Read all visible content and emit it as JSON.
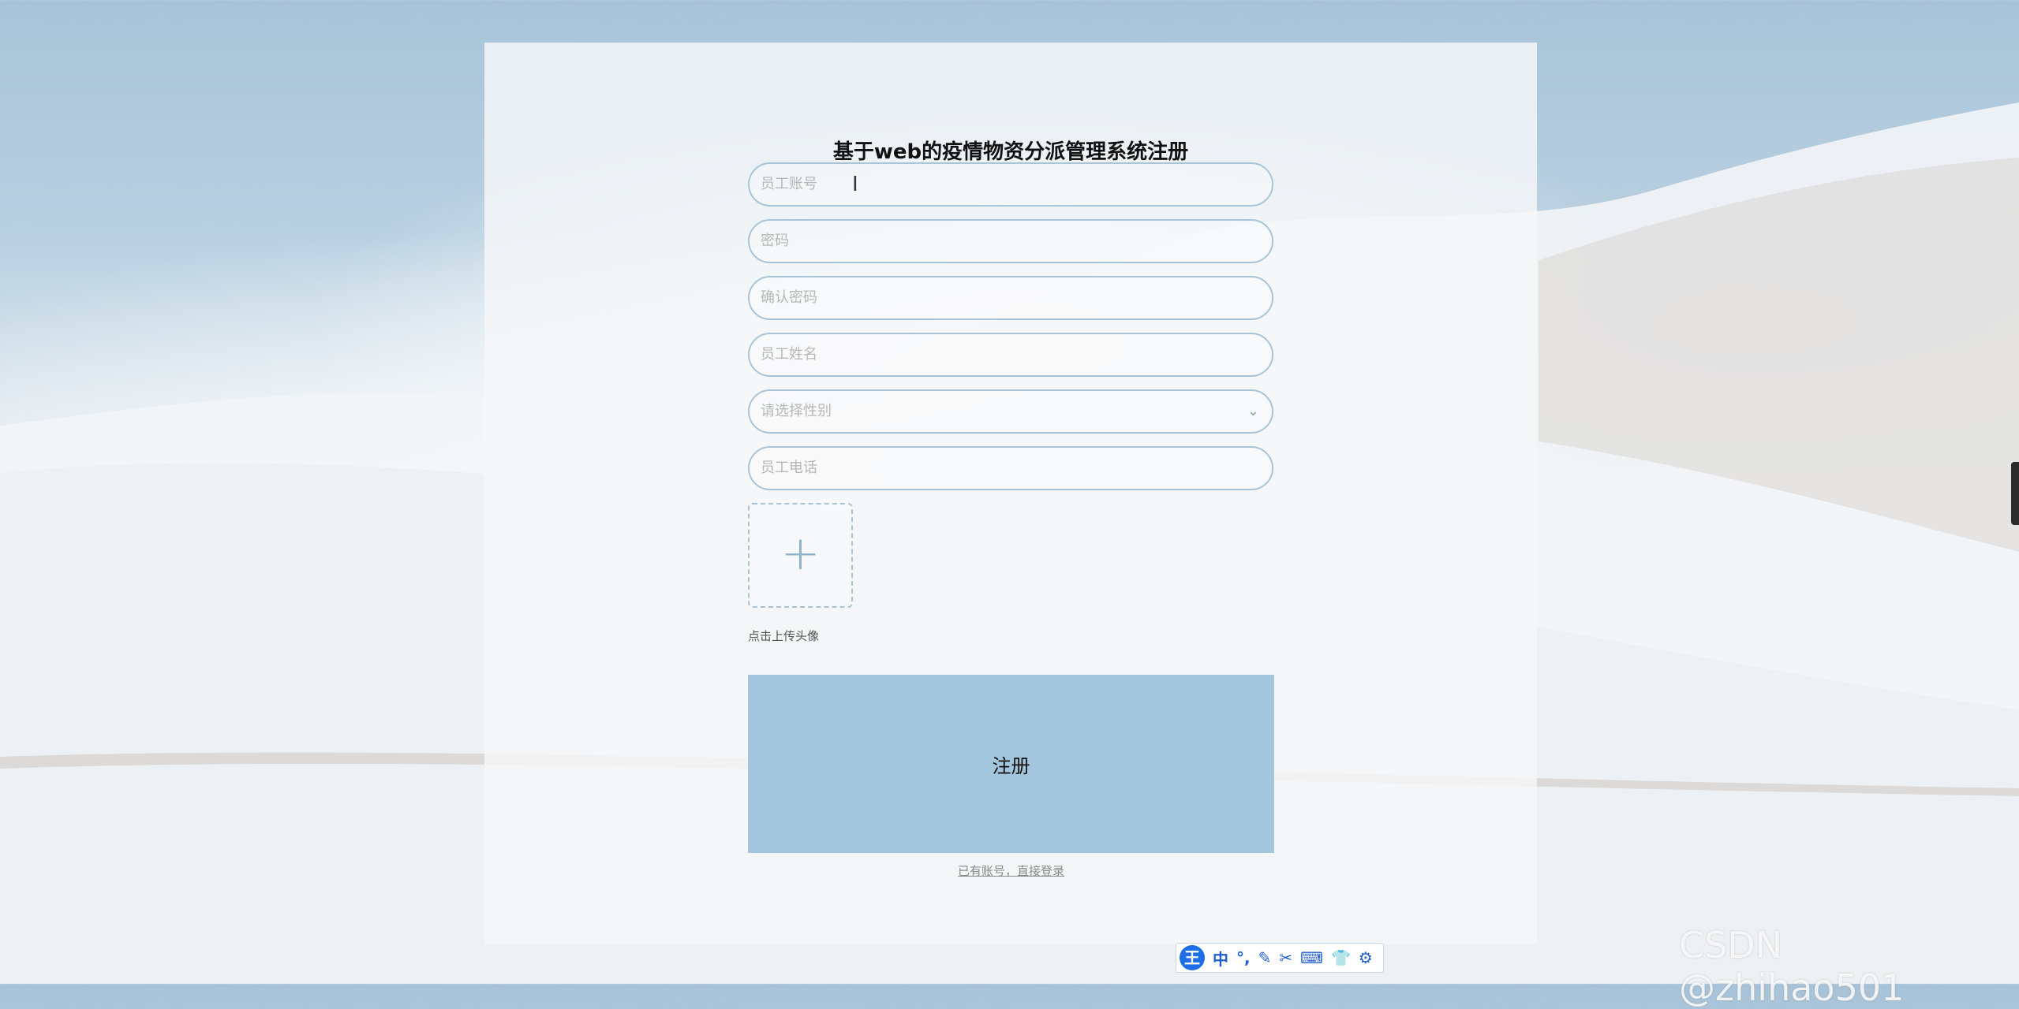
{
  "page": {
    "title": "基于web的疫情物资分派管理系统注册"
  },
  "form": {
    "account_placeholder": "员工账号",
    "password_placeholder": "密码",
    "confirm_password_placeholder": "确认密码",
    "name_placeholder": "员工姓名",
    "gender_placeholder": "请选择性别",
    "phone_placeholder": "员工电话",
    "upload_label": "点击上传头像",
    "submit_label": "注册",
    "login_link": "已有账号，直接登录"
  },
  "ime_toolbar": {
    "logo": "王",
    "tools": [
      "中",
      "°,",
      "✎",
      "✂",
      "⌨",
      "👕",
      "⚙"
    ]
  },
  "watermark": "CSDN @zhihao501",
  "colors": {
    "accent": "#a4c5de",
    "input_border": "#a8c4d6",
    "ime_blue": "#1e6ee6"
  },
  "icons": {
    "upload": "plus-icon",
    "select": "chevron-down-icon",
    "text_cursor": "text-cursor-icon"
  }
}
